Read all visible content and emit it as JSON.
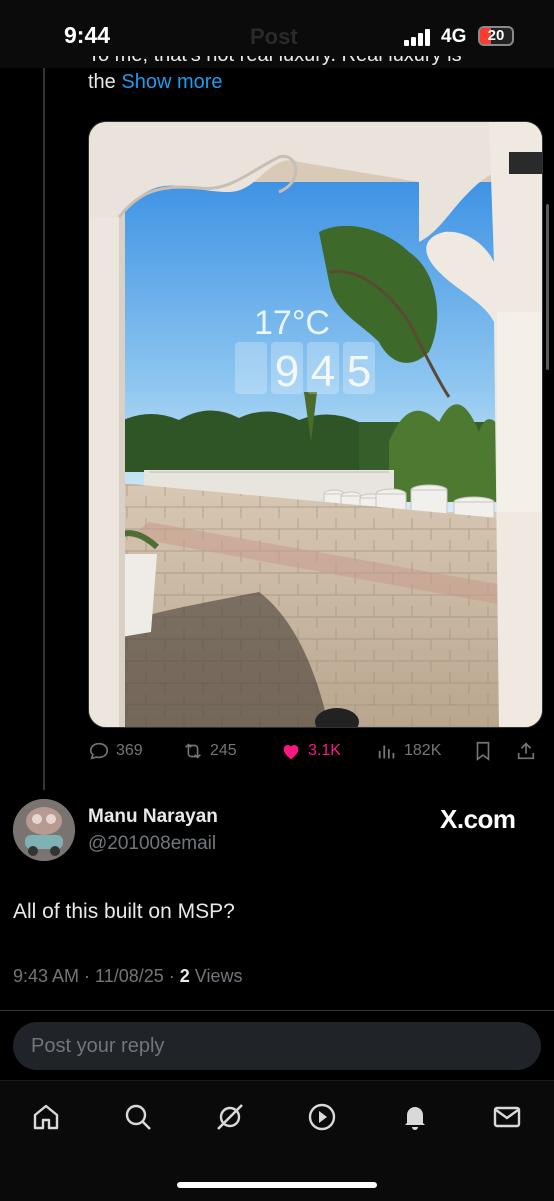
{
  "status_bar": {
    "time": "9:44",
    "network": "4G",
    "battery": "20",
    "header_ghost": "Post"
  },
  "post": {
    "text_partial": "To me, that's not real luxury. Real luxury is",
    "text_tail": "the",
    "show_more": "Show more",
    "media_overlay": {
      "temperature": "17°C",
      "clock_digits": [
        "9",
        "4",
        "5"
      ]
    },
    "actions": {
      "replies": "369",
      "reposts": "245",
      "likes": "3.1K",
      "views": "182K"
    }
  },
  "reply": {
    "author_name": "Manu Narayan",
    "author_handle": "@201008email",
    "site_link": "X.com",
    "text": "All of this built on MSP?",
    "timestamp": "9:43 AM · 11/08/25 · ",
    "views_count": "2",
    "views_label": " Views"
  },
  "composer": {
    "placeholder": "Post your reply"
  },
  "bottom_nav": {
    "items": [
      "home-icon",
      "search-icon",
      "grok-icon",
      "video-icon",
      "notifications-icon",
      "messages-icon"
    ]
  },
  "colors": {
    "accent": "#1d9bf0",
    "like": "#f91880",
    "muted": "#71767b",
    "background": "#000000"
  }
}
